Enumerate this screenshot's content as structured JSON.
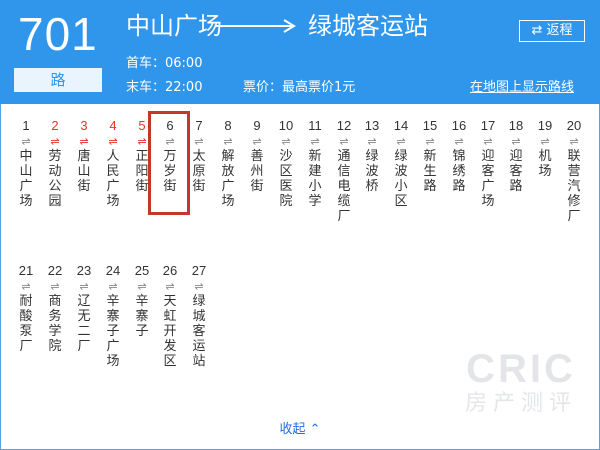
{
  "route": {
    "number": "701",
    "suffix": "路",
    "from": "中山广场",
    "to": "绿城客运站",
    "first_bus": "首车：06:00",
    "last_bus": "末车：22:00",
    "fare": "票价：最高票价1元",
    "return_label": "⇄ 返程",
    "map_link": "在地图上显示路线"
  },
  "direction_glyph": "⇌",
  "stops": [
    {
      "num": "1",
      "name": "中山广场",
      "passed": false
    },
    {
      "num": "2",
      "name": "劳动公园",
      "passed": true
    },
    {
      "num": "3",
      "name": "唐山街",
      "passed": true
    },
    {
      "num": "4",
      "name": "人民广场",
      "passed": true
    },
    {
      "num": "5",
      "name": "正阳街",
      "passed": true
    },
    {
      "num": "6",
      "name": "万岁街",
      "passed": false
    },
    {
      "num": "7",
      "name": "太原街",
      "passed": false
    },
    {
      "num": "8",
      "name": "解放广场",
      "passed": false
    },
    {
      "num": "9",
      "name": "善州街",
      "passed": false
    },
    {
      "num": "10",
      "name": "沙区医院",
      "passed": false
    },
    {
      "num": "11",
      "name": "新建小学",
      "passed": false
    },
    {
      "num": "12",
      "name": "通信电缆厂",
      "passed": false
    },
    {
      "num": "13",
      "name": "绿波桥",
      "passed": false
    },
    {
      "num": "14",
      "name": "绿波小区",
      "passed": false
    },
    {
      "num": "15",
      "name": "新生路",
      "passed": false
    },
    {
      "num": "16",
      "name": "锦绣路",
      "passed": false
    },
    {
      "num": "17",
      "name": "迎客广场",
      "passed": false
    },
    {
      "num": "18",
      "name": "迎客路",
      "passed": false
    },
    {
      "num": "19",
      "name": "机场",
      "passed": false
    },
    {
      "num": "20",
      "name": "联营汽修厂",
      "passed": false
    },
    {
      "num": "21",
      "name": "耐酸泵厂",
      "passed": false
    },
    {
      "num": "22",
      "name": "商务学院",
      "passed": false
    },
    {
      "num": "23",
      "name": "辽无二厂",
      "passed": false
    },
    {
      "num": "24",
      "name": "辛寨子广场",
      "passed": false
    },
    {
      "num": "25",
      "name": "辛寨子",
      "passed": false
    },
    {
      "num": "26",
      "name": "天虹开发区",
      "passed": false
    },
    {
      "num": "27",
      "name": "绿城客运站",
      "passed": false
    }
  ],
  "selected_stop": "6",
  "collapse_label": "收起 ⌃",
  "watermark": {
    "line1": "CRIC",
    "line2": "房产测评"
  },
  "colors": {
    "header": "#2f96eb",
    "accent": "#1e6fd9",
    "passed": "#e8322c",
    "highlight": "#c0392b"
  }
}
